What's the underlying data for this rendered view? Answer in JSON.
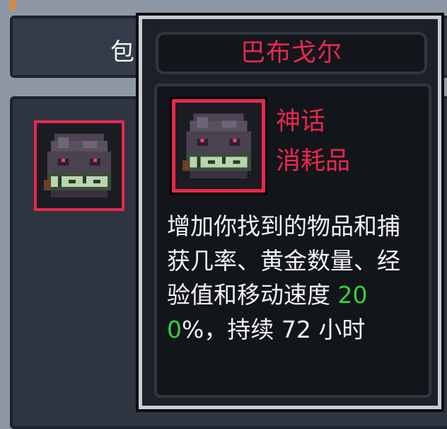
{
  "background_panel": {
    "header_label": "包",
    "header_right_fragment": "l"
  },
  "tooltip": {
    "item_name": "巴布戈尔",
    "rarity": "神话",
    "item_type": "消耗品",
    "description_before": "增加你找到的物品和捕获几率、黄金数量、经验值和移动速度 ",
    "description_highlight": "200",
    "description_after": "%，持续 72 小时"
  },
  "icons": {
    "item_icon": "skull-mask-icon"
  },
  "colors": {
    "mythic_red": "#e8284e",
    "highlight_green": "#35d23a",
    "text_white": "#f2f2f2",
    "panel_dark": "#1c2027",
    "tooltip_border": "#c8ccd2"
  }
}
